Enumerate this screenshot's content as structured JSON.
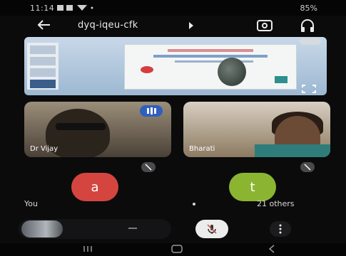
{
  "status_bar": {
    "time": "11:14",
    "right_text": "85%"
  },
  "app_bar": {
    "meeting_code": "dyq-iqeu-cfk"
  },
  "participants": [
    {
      "name": "Dr Vijay"
    },
    {
      "name": "Bharati"
    }
  ],
  "audio_tiles": [
    {
      "initial": "a",
      "label": "You"
    },
    {
      "initial": "t",
      "label": "21 others"
    }
  ],
  "colors": {
    "avatar_a": "#d4453f",
    "avatar_t": "#8bb531",
    "background": "#0b0b0c"
  }
}
